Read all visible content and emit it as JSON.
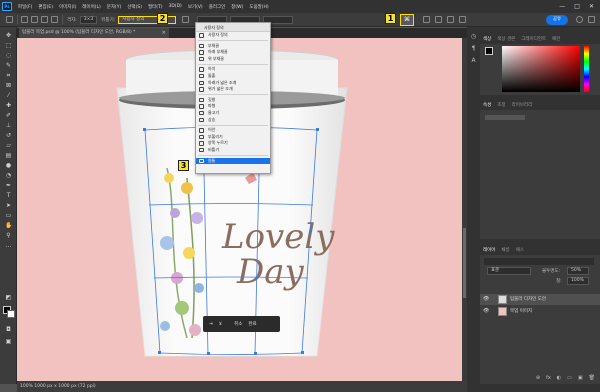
{
  "menubar": {
    "app_badge": "Ps",
    "items": [
      "파일(F)",
      "편집(E)",
      "이미지(I)",
      "레이어(L)",
      "문자(Y)",
      "선택(S)",
      "필터(T)",
      "3D(D)",
      "보기(V)",
      "플러그인",
      "창(W)",
      "도움말(H)"
    ],
    "window_controls": [
      "—",
      "□",
      "✕"
    ]
  },
  "options_bar": {
    "grid_label": "격자:",
    "grid_value": "3×3",
    "warp_label": "뒤틀기:",
    "warp_dropdown_label": "사용자 정의",
    "share_label": "공유",
    "warp_mode_icon": "⌘"
  },
  "document_tab": {
    "title": "텀블러 목업.psd @ 100% (텀블러 디자인 도안, RGB/8) *",
    "close": "×"
  },
  "status_bar": {
    "text": "100%   1000 px x 1000 px (72 ppi)"
  },
  "warp_menu": {
    "header": "사용자 정의",
    "sections": [
      [
        {
          "label": "사용자 정의",
          "icon": "custom-icon"
        }
      ],
      [
        {
          "label": "부채꼴",
          "icon": "arc-icon"
        },
        {
          "label": "아래 부채꼴",
          "icon": "arc-lower-icon"
        },
        {
          "label": "위 부채꼴",
          "icon": "arc-upper-icon"
        }
      ],
      [
        {
          "label": "아치",
          "icon": "arch-icon"
        },
        {
          "label": "돌출",
          "icon": "bulge-icon"
        },
        {
          "label": "아래가 넓은 조개",
          "icon": "shell-lower-icon"
        },
        {
          "label": "위가 넓은 조개",
          "icon": "shell-upper-icon"
        }
      ],
      [
        {
          "label": "깃발",
          "icon": "flag-icon"
        },
        {
          "label": "파형",
          "icon": "wave-icon"
        },
        {
          "label": "물고기",
          "icon": "fish-icon"
        },
        {
          "label": "상승",
          "icon": "rise-icon"
        }
      ],
      [
        {
          "label": "어안",
          "icon": "fisheye-icon"
        },
        {
          "label": "부풀리기",
          "icon": "inflate-icon"
        },
        {
          "label": "양쪽 누르기",
          "icon": "squeeze-icon"
        },
        {
          "label": "비틀기",
          "icon": "twist-icon"
        }
      ],
      [
        {
          "label": "원통",
          "icon": "cylinder-icon",
          "selected": true
        }
      ]
    ]
  },
  "callouts": {
    "one": "1",
    "two": "2",
    "three": "3"
  },
  "canvas": {
    "background_color": "#f2c2c0",
    "artwork_text_line1": "Lovely",
    "artwork_text_line2": "Day"
  },
  "warp_context_bar": {
    "items": [
      "⇥",
      "⊻",
      "취소",
      "완료"
    ]
  },
  "right_panels": {
    "color_tabs": [
      "색상",
      "색상 견본",
      "그레이디언트",
      "패턴"
    ],
    "properties_tabs": [
      "속성",
      "조정",
      "라이브러리"
    ],
    "layers_tabs": [
      "레이어",
      "채널",
      "패스"
    ],
    "blend_mode": "표준",
    "opacity_label": "불투명도:",
    "opacity_value": "50%",
    "fill_label": "칠:",
    "fill_value": "100%",
    "layers": [
      {
        "name": "텀블러 디자인 도안",
        "selected": true
      },
      {
        "name": "목업 이미지",
        "selected": false
      }
    ],
    "bottom_icons": [
      "⊕",
      "fx",
      "◐",
      "▭",
      "▣",
      "🗑"
    ]
  },
  "colors": {
    "accent": "#1473e6",
    "callout_yellow": "#f7e32f",
    "canvas_pink": "#f2c2c0",
    "transform_blue": "#3d7bd9"
  }
}
